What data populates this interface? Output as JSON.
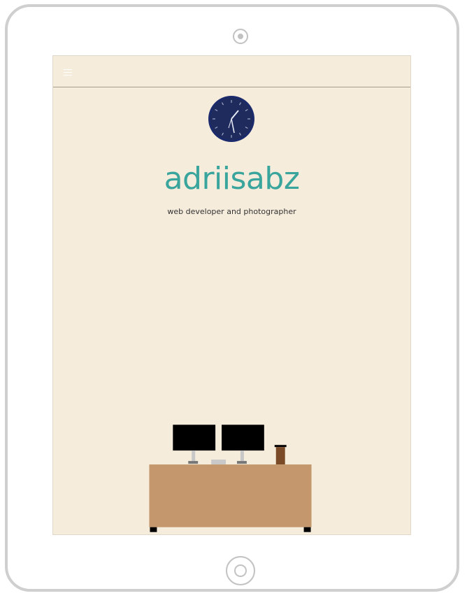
{
  "device": {
    "type": "tablet"
  },
  "topbar": {
    "menu_icon": "hamburger-menu-icon"
  },
  "hero": {
    "clock_icon": "wall-clock-icon",
    "title": "adriisabz",
    "subtitle": "web developer and photographer"
  },
  "colors": {
    "screen_background": "#f5ecdc",
    "title": "#3aa59c",
    "clock_face": "#1b2a6b",
    "desk": "#c4986c",
    "monitor": "#000000",
    "cup": "#7a4b26"
  }
}
